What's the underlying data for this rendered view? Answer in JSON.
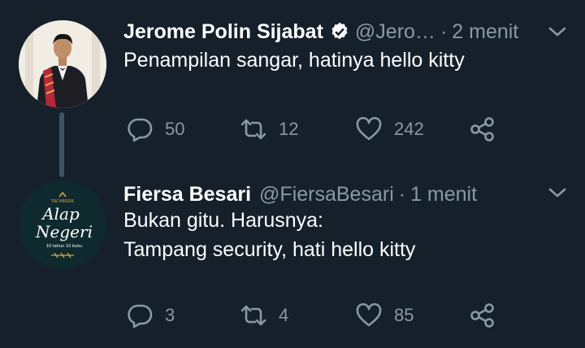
{
  "tweets": [
    {
      "name": "Jerome Polin Sijabat",
      "verified": true,
      "handle": "@Jero…",
      "separator": "·",
      "time": "2 menit",
      "lines": [
        "Penampilan sangar, hatinya hello kitty"
      ],
      "replies": "50",
      "retweets": "12",
      "likes": "242"
    },
    {
      "name": "Fiersa Besari",
      "verified": false,
      "handle": "@FiersaBesari",
      "separator": "·",
      "time": "1 menit",
      "lines": [
        "Bukan gitu. Harusnya:",
        "Tampang security, hati hello kitty"
      ],
      "replies": "3",
      "retweets": "4",
      "likes": "85",
      "avatar_logo_text": [
        "TACHBOOK",
        "Alap",
        "Negeri",
        "10 tahun 10 buku"
      ]
    }
  ],
  "colors": {
    "background": "#15202b",
    "secondary_text": "#8899a6",
    "thread_line": "#3d5466",
    "verified_badge": "#ffffff"
  },
  "icons": [
    "verified-badge-icon",
    "chevron-down-icon",
    "reply-icon",
    "retweet-icon",
    "like-icon",
    "share-icon"
  ]
}
